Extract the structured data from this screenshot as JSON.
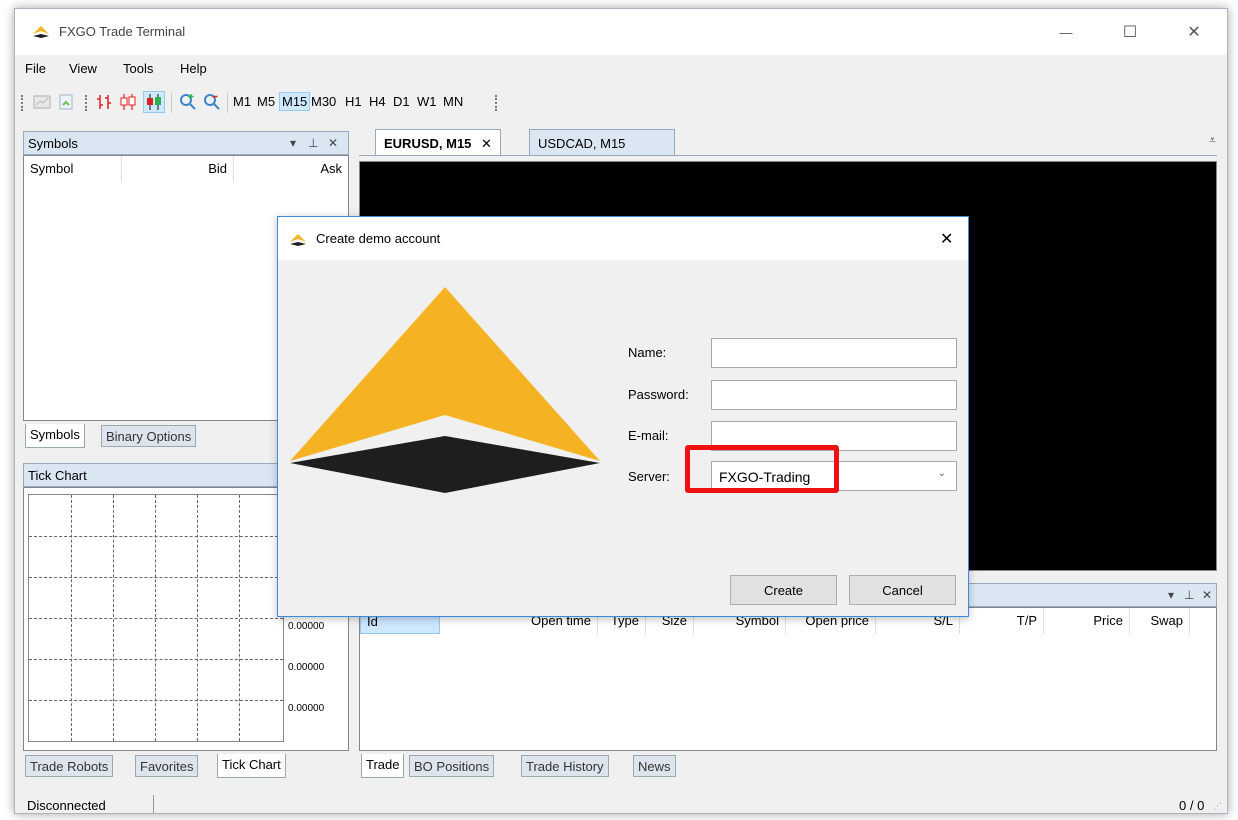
{
  "app": {
    "title": "FXGO Trade Terminal",
    "brand_color": "#f5b324",
    "dark_color": "#1e1e1e"
  },
  "window_controls": {
    "minimize": "—",
    "maximize": "☐",
    "close": "✕"
  },
  "menu": [
    "File",
    "View",
    "Tools",
    "Help"
  ],
  "toolbar": {
    "icons": [
      "new-chart-icon",
      "template-icon",
      "bar-chart-icon",
      "candlestick-icon",
      "candlestick-colored-icon",
      "zoom-in-icon",
      "zoom-out-icon"
    ],
    "timeframes": [
      "M1",
      "M5",
      "M15",
      "M30",
      "H1",
      "H4",
      "D1",
      "W1",
      "MN"
    ],
    "selected_timeframe": "M15"
  },
  "symbols_panel": {
    "title": "Symbols",
    "columns": [
      "Symbol",
      "Bid",
      "Ask"
    ],
    "tabs": [
      "Symbols",
      "Binary Options"
    ],
    "active_tab": "Symbols"
  },
  "tick_chart_panel": {
    "title": "Tick Chart",
    "values": [
      "0.00000",
      "0.00000",
      "0.00000"
    ],
    "tabs": [
      "Trade Robots",
      "Favorites",
      "Tick Chart"
    ],
    "active_tab": "Tick Chart"
  },
  "document_tabs": [
    "EURUSD, M15",
    "USDCAD, M15"
  ],
  "document_tab_close": "✕",
  "trade_panel": {
    "columns": [
      "Id",
      "Open time",
      "Type",
      "Size",
      "Symbol",
      "Open price",
      "S/L",
      "T/P",
      "Price",
      "Swap"
    ],
    "tabs": [
      "Trade",
      "BO Positions",
      "Trade History",
      "News"
    ],
    "active_tab": "Trade"
  },
  "panel_controls": {
    "dropdown": "▾",
    "pin": "⊥",
    "close": "✕"
  },
  "dialog": {
    "title": "Create demo account",
    "close": "✕",
    "fields": {
      "name_label": "Name:",
      "name_value": "",
      "password_label": "Password:",
      "password_value": "",
      "email_label": "E-mail:",
      "email_value": "",
      "server_label": "Server:",
      "server_value": "FXGO-Trading"
    },
    "create_label": "Create",
    "cancel_label": "Cancel",
    "highlight_color": "#ee1111"
  },
  "status": {
    "connection": "Disconnected",
    "counter": "0 / 0"
  }
}
